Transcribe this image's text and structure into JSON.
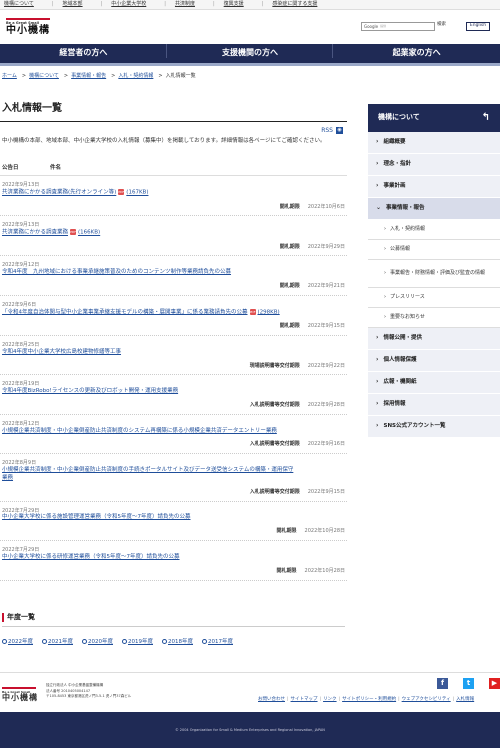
{
  "top_links": [
    "機構について",
    "地域本部",
    "中小企業大学校",
    "共済制度",
    "復興支援",
    "感染症に関する支援"
  ],
  "header": {
    "logo_tagline": "Be a Great Small",
    "logo_name": "中小機構",
    "search_label": "Google",
    "search_placeholder": "提供",
    "search_button": "検索",
    "english_button": "English"
  },
  "main_nav": [
    "経営者の方へ",
    "支援機関の方へ",
    "起業家の方へ"
  ],
  "breadcrumb": [
    "ホーム",
    "機構について",
    "事業情報・報告",
    "入札・契約情報",
    "入札情報一覧"
  ],
  "page_title": "入札情報一覧",
  "rss_label": "RSS",
  "intro": "中小機構の本部、地域本部、中小企業大学校の入札情報（募集中）を掲載しております。詳細情報は各ページにてご確認ください。",
  "columns": {
    "date": "公告日",
    "name": "件名"
  },
  "bids": [
    {
      "date": "2022年9月13日",
      "title": "共済業務にかかる調査業務(先行オンライン等)",
      "pdf": "(167KB)",
      "meta_label": "開札期限",
      "meta_value": "2022年10月6日"
    },
    {
      "date": "2022年9月13日",
      "title": "共済業務にかかる調査業務",
      "pdf": "(166KB)",
      "meta_label": "開札期限",
      "meta_value": "2022年9月29日"
    },
    {
      "date": "2022年9月12日",
      "title": "令和4年度　九州地域における事業承継施策普及のためのコンテンツ制作等業務請負先の公募",
      "pdf": "",
      "meta_label": "開札期限",
      "meta_value": "2022年9月21日"
    },
    {
      "date": "2022年9月6日",
      "title": "「令和4年度自治体関与型中小企業事業承継支援モデルの構築・展開事業」に係る業務請負先の公募",
      "pdf": "(298KB)",
      "meta_label": "開札期限",
      "meta_value": "2022年9月15日"
    },
    {
      "date": "2022年8月25日",
      "title": "令和4年度中小企業大学校広島校建物修繕等工事",
      "pdf": "",
      "meta_label": "現場説明書等交付期限",
      "meta_value": "2022年9月22日"
    },
    {
      "date": "2022年8月19日",
      "title": "令和4年度BizRobo!ライセンスの更新及びロボット開発・運用支援業務",
      "pdf": "",
      "meta_label": "入札説明書等交付期限",
      "meta_value": "2022年9月28日"
    },
    {
      "date": "2022年8月12日",
      "title": "小規模企業共済制度・中小企業倒産防止共済制度のシステム再構築に係る小規模企業共済データエントリー業務",
      "pdf": "",
      "meta_label": "入札説明書等交付期限",
      "meta_value": "2022年9月16日"
    },
    {
      "date": "2022年8月9日",
      "title": "小規模企業共済制度・中小企業倒産防止共済制度の手続きポータルサイト及びデータ送受信システムの構築・運用保守業務",
      "pdf": "",
      "meta_label": "入札説明書等交付期限",
      "meta_value": "2022年9月15日"
    },
    {
      "date": "2022年7月29日",
      "title": "中小企業大学校に係る施設管理運営業務（令和5年度〜7年度）請負先の公募",
      "pdf": "",
      "meta_label": "開札期限",
      "meta_value": "2022年10月28日"
    },
    {
      "date": "2022年7月29日",
      "title": "中小企業大学校に係る研修運営業務（令和5年度〜7年度）請負先の公募",
      "pdf": "",
      "meta_label": "開札期限",
      "meta_value": "2022年10月28日"
    }
  ],
  "year_section_title": "年度一覧",
  "years": [
    "2022年度",
    "2021年度",
    "2020年度",
    "2019年度",
    "2018年度",
    "2017年度"
  ],
  "sidebar": {
    "title": "機構について",
    "items": [
      {
        "label": "組織概要",
        "type": "item"
      },
      {
        "label": "理念・指針",
        "type": "item"
      },
      {
        "label": "事業計画",
        "type": "item"
      },
      {
        "label": "事業情報・報告",
        "type": "active"
      },
      {
        "label": "入札・契約情報",
        "type": "sub"
      },
      {
        "label": "公募情報",
        "type": "sub"
      },
      {
        "label": "事業報告・財務情報・評価及び監査の情報",
        "type": "sub"
      },
      {
        "label": "プレスリリース",
        "type": "sub"
      },
      {
        "label": "重要なお知らせ",
        "type": "sub"
      },
      {
        "label": "情報公開・提供",
        "type": "item"
      },
      {
        "label": "個人情報保護",
        "type": "item"
      },
      {
        "label": "広報・機関紙",
        "type": "item"
      },
      {
        "label": "採用情報",
        "type": "item"
      },
      {
        "label": "SNS公式アカウント一覧",
        "type": "item"
      }
    ]
  },
  "footer": {
    "logo_tagline": "Be a Great Small",
    "logo_name": "中小機構",
    "address_lines": [
      "独立行政法人 中小企業基盤整備機構",
      "法人番号 2010405004147",
      "〒105-8453 東京都港区虎ノ門3-5-1 虎ノ門37森ビル"
    ],
    "links": [
      "お問い合わせ",
      "サイトマップ",
      "リンク",
      "サイトポリシー・利用規約",
      "ウェブアクセシビリティ",
      "入札情報"
    ],
    "copyright": "© 2004 Organization for Small & Medium Enterprises and Regional Innovation, JAPAN",
    "social": [
      {
        "icon": "facebook-icon",
        "glyph": "f",
        "color": "#3b5998"
      },
      {
        "icon": "twitter-icon",
        "glyph": "t",
        "color": "#1da1f2"
      },
      {
        "icon": "youtube-icon",
        "glyph": "▶",
        "color": "#e02020"
      }
    ]
  }
}
